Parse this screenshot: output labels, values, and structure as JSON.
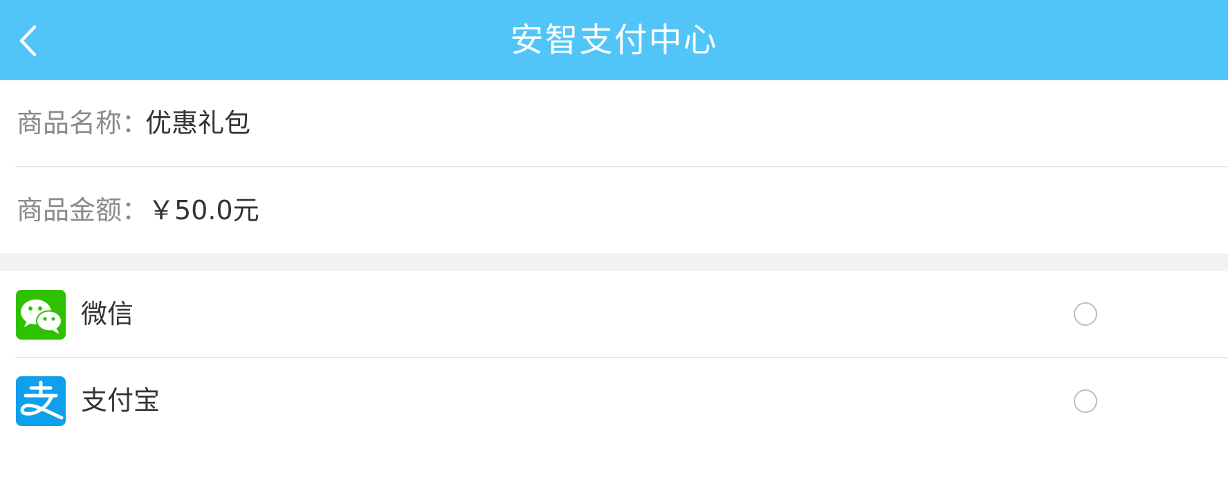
{
  "header": {
    "title": "安智支付中心",
    "back_icon": "chevron-left-icon",
    "background_color": "#52c5f8"
  },
  "product": {
    "name_label": "商品名称：",
    "name_value": "优惠礼包",
    "amount_label": "商品金额：",
    "amount_value": "￥50.0元"
  },
  "payment_methods": [
    {
      "label": "微信",
      "icon": "wechat-icon",
      "color": "#2dc100",
      "selected": false
    },
    {
      "label": "支付宝",
      "icon": "alipay-icon",
      "color": "#0ea0ec",
      "selected": false
    }
  ]
}
